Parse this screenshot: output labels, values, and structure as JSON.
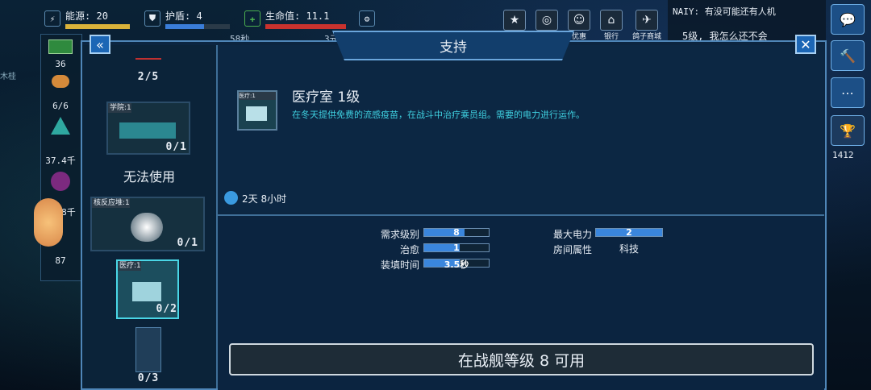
{
  "hud": {
    "energy_label": "能源:",
    "energy_value": "20",
    "shield_label": "护盾:",
    "shield_value": "4",
    "hp_label": "生命值:",
    "hp_value": "11.1",
    "timer_partial": "58秒",
    "partial_label": "3元"
  },
  "top_icons": [
    {
      "name": "star-icon",
      "label": ""
    },
    {
      "name": "compass-icon",
      "label": ""
    },
    {
      "name": "badge-icon",
      "label": "优惠"
    },
    {
      "name": "bank-icon",
      "label": "银行"
    },
    {
      "name": "bird-icon",
      "label": "鸽子商城"
    }
  ],
  "chat": {
    "line1": "NAIY: 有没可能还有人机",
    "line2": "5级, 我怎么还不会"
  },
  "left_strip": {
    "v1": "36",
    "v2": "6/6",
    "v3": "37.4千",
    "v4": "24.8千",
    "v5": "87"
  },
  "left_tag": "木桂",
  "right_trophy_value": "1412",
  "panel": {
    "title": "支持",
    "back_icon": "double-chevron-left-icon",
    "close_icon": "close-icon"
  },
  "room_list": [
    {
      "header": "",
      "count": "2/5"
    },
    {
      "header": "学院:1",
      "count": "0/1",
      "status": "无法使用"
    },
    {
      "header": "核反应堆:1",
      "count": "0/1"
    },
    {
      "header": "医疗:1",
      "count": "0/2",
      "selected": true
    },
    {
      "header": "",
      "count": "0/3"
    }
  ],
  "detail": {
    "thumb_header": "医疗:1",
    "name": "医疗室 1级",
    "description": "在冬天提供免费的流感疫苗，在战斗中治疗乘员组。需要的电力进行运作。",
    "build_time": "2天 8小时"
  },
  "stats": {
    "required_level_label": "需求级别",
    "required_level_value": "8",
    "required_level_fill": 0.62,
    "heal_label": "治愈",
    "heal_value": "1",
    "heal_fill": 0.55,
    "reload_label": "装填时间",
    "reload_value": "3.5秒",
    "reload_fill": 0.55,
    "max_power_label": "最大电力",
    "max_power_value": "2",
    "max_power_fill": 1.0,
    "room_type_label": "房间属性",
    "room_type_value": "科技"
  },
  "availability": "在战舰等级 8 可用"
}
